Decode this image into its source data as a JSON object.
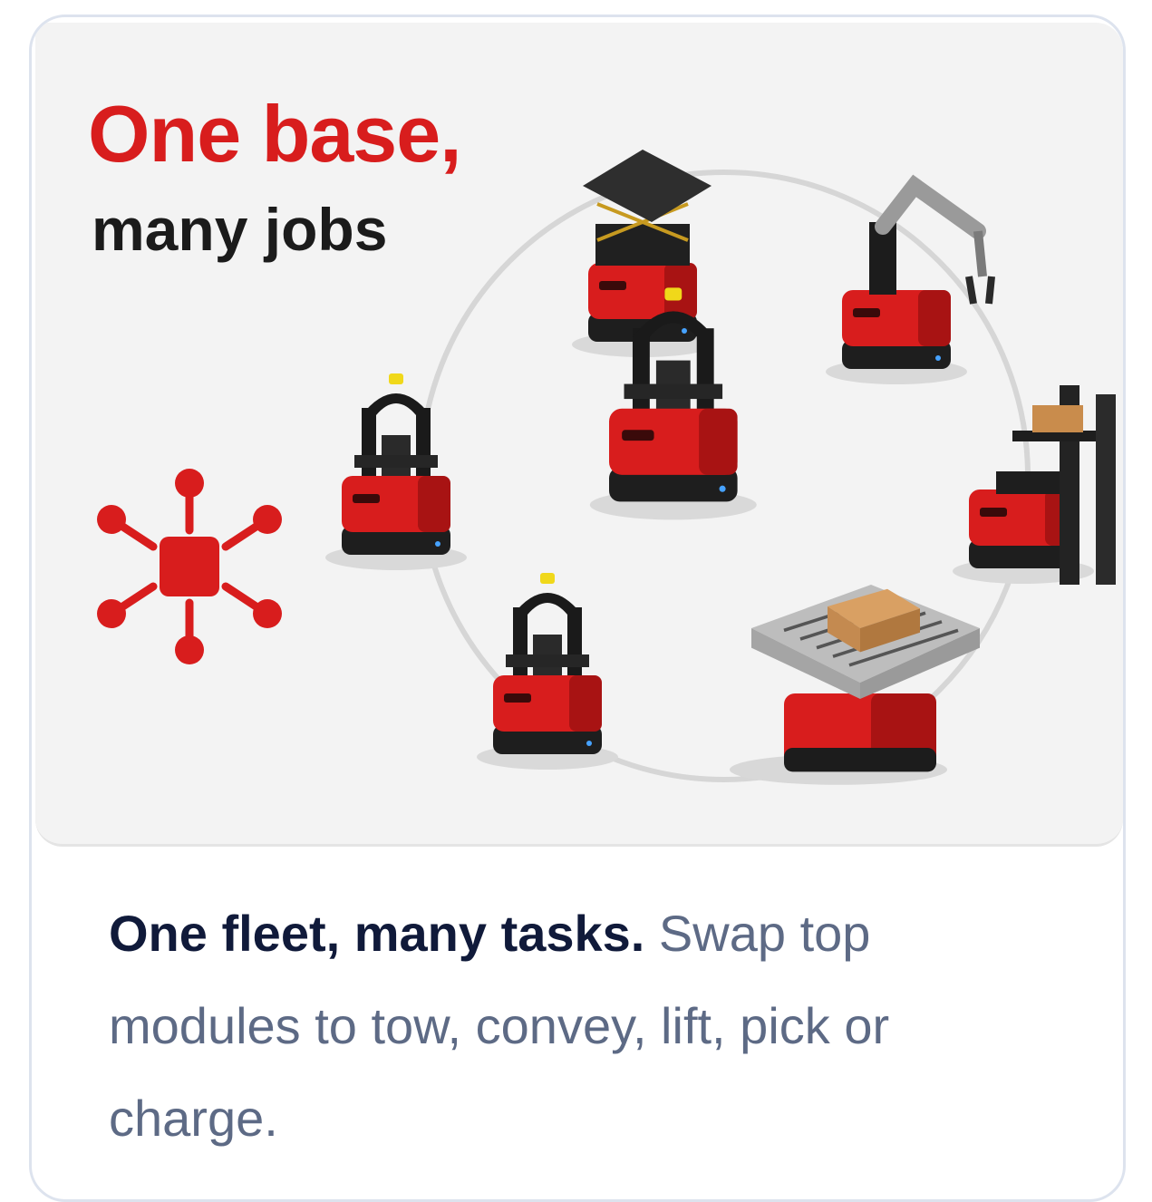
{
  "image": {
    "headline": "One base,",
    "subhead": "many jobs"
  },
  "caption": {
    "lead": "One fleet, many tasks.",
    "body": " Swap top modules to tow, convey, lift, pick or charge."
  },
  "icons": [
    "modular-hub-icon"
  ],
  "colors": {
    "brand_red": "#d81d1d",
    "title_navy": "#101a3a",
    "body_slate": "#5d6a85"
  }
}
